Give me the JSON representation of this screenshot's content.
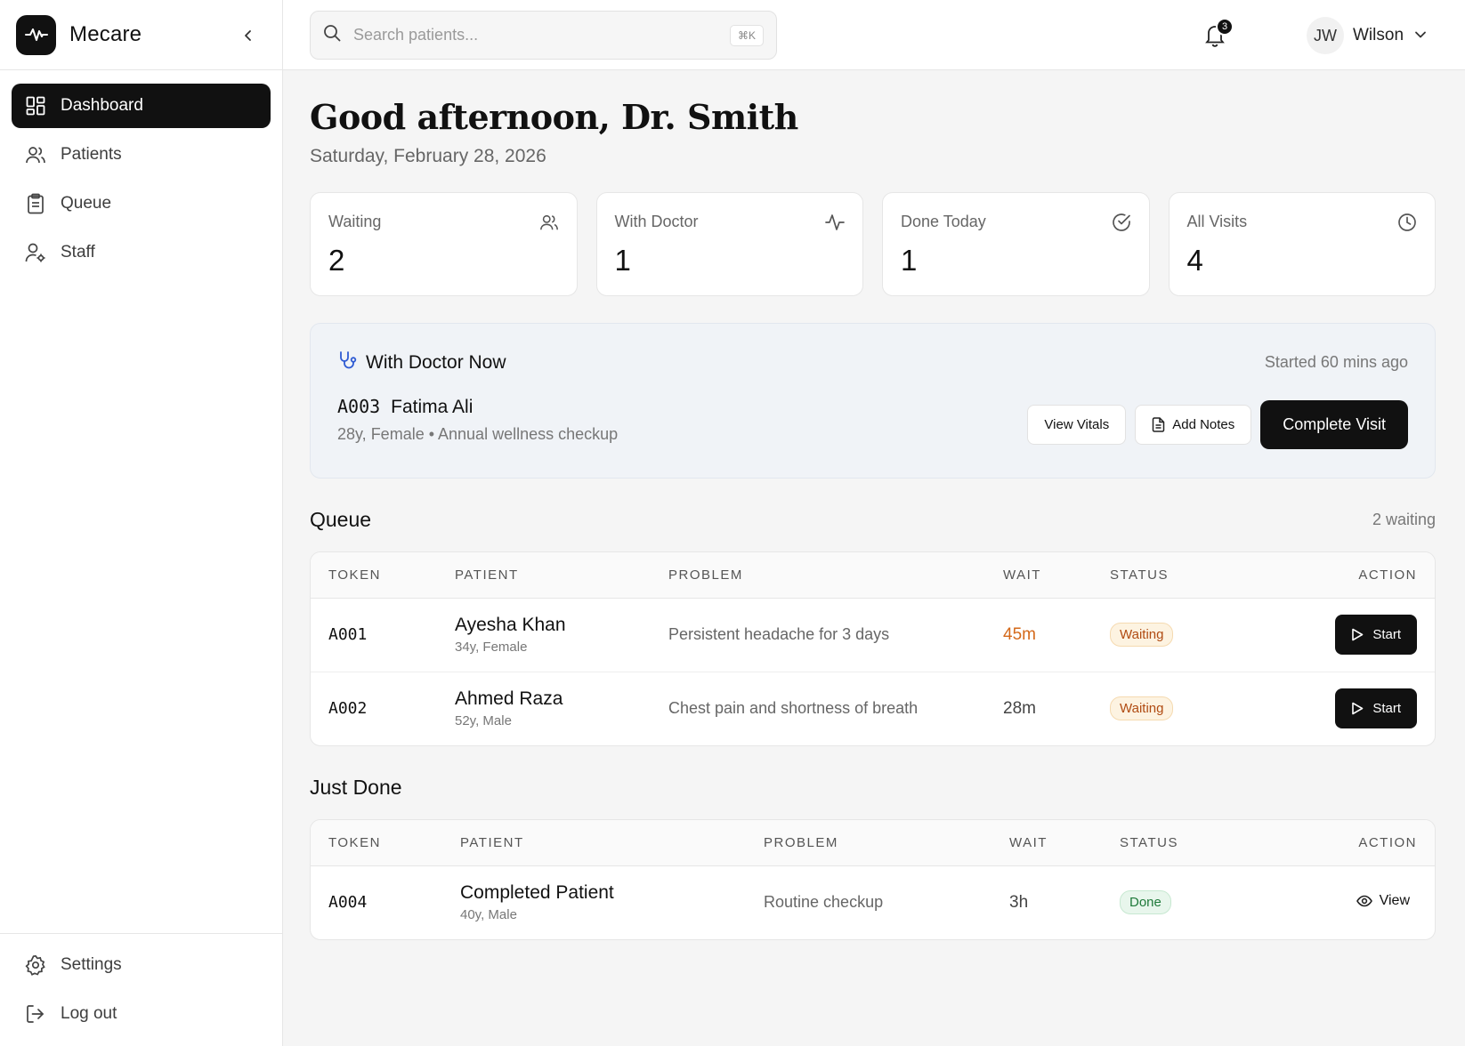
{
  "app": {
    "name": "Mecare"
  },
  "sidebar": {
    "items": [
      {
        "label": "Dashboard",
        "icon": "dashboard-grid-icon",
        "active": true
      },
      {
        "label": "Patients",
        "icon": "users-icon"
      },
      {
        "label": "Queue",
        "icon": "clipboard-icon"
      },
      {
        "label": "Staff",
        "icon": "user-gear-icon"
      }
    ],
    "bottom": [
      {
        "label": "Settings",
        "icon": "gear-icon"
      },
      {
        "label": "Log out",
        "icon": "logout-icon"
      }
    ]
  },
  "topbar": {
    "search_placeholder": "Search patients...",
    "search_shortcut": "⌘K",
    "notifications_count": "3",
    "user_initials": "JW",
    "user_name": "Wilson"
  },
  "header": {
    "greeting": "Good afternoon, Dr. Smith",
    "date": "Saturday, February 28, 2026"
  },
  "stats": [
    {
      "label": "Waiting",
      "value": "2",
      "icon": "users-icon"
    },
    {
      "label": "With Doctor",
      "value": "1",
      "icon": "activity-icon"
    },
    {
      "label": "Done Today",
      "value": "1",
      "icon": "check-circle-icon"
    },
    {
      "label": "All Visits",
      "value": "4",
      "icon": "clock-icon"
    }
  ],
  "current": {
    "title": "With Doctor Now",
    "started": "Started 60 mins ago",
    "token": "A003",
    "name": "Fatima Ali",
    "meta": "28y, Female • Annual wellness checkup",
    "view_vitals": "View Vitals",
    "add_notes": "Add Notes",
    "complete": "Complete Visit"
  },
  "queue": {
    "title": "Queue",
    "note": "2 waiting",
    "columns": [
      "TOKEN",
      "PATIENT",
      "PROBLEM",
      "WAIT",
      "STATUS",
      "ACTION"
    ],
    "rows": [
      {
        "token": "A001",
        "name": "Ayesha Khan",
        "meta": "34y, Female",
        "problem": "Persistent headache for 3 days",
        "wait": "45m",
        "status": "Waiting",
        "action": "Start"
      },
      {
        "token": "A002",
        "name": "Ahmed Raza",
        "meta": "52y, Male",
        "problem": "Chest pain and shortness of breath",
        "wait": "28m",
        "status": "Waiting",
        "action": "Start"
      }
    ]
  },
  "done": {
    "title": "Just Done",
    "columns": [
      "TOKEN",
      "PATIENT",
      "PROBLEM",
      "WAIT",
      "STATUS",
      "ACTION"
    ],
    "rows": [
      {
        "token": "A004",
        "name": "Completed Patient",
        "meta": "40y, Male",
        "problem": "Routine checkup",
        "wait": "3h",
        "status": "Done",
        "action": "View"
      }
    ]
  },
  "colors": {
    "accent_dark": "#111111",
    "waiting_text": "#b04b12",
    "waiting_bg": "#fdf3e1",
    "done_text": "#1f7a3a",
    "done_bg": "#e8f6ec",
    "wait_warn": "#d4691a",
    "stethoscope": "#2f5bd3"
  }
}
